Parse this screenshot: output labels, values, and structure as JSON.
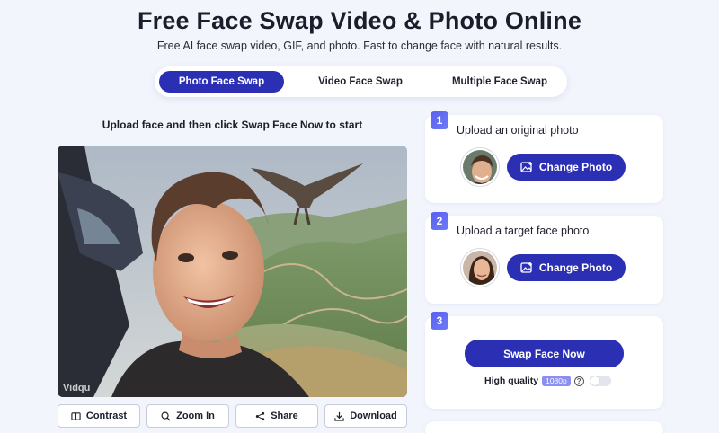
{
  "header": {
    "title": "Free Face Swap Video & Photo Online",
    "subtitle": "Free AI face swap video, GIF, and photo. Fast to change face with natural results."
  },
  "tabs": [
    {
      "label": "Photo Face Swap",
      "active": true
    },
    {
      "label": "Video Face Swap",
      "active": false
    },
    {
      "label": "Multiple Face Swap",
      "active": false
    }
  ],
  "preview": {
    "hint": "Upload face and then click Swap Face Now to start",
    "watermark": "Vidqu"
  },
  "actions": [
    {
      "label": "Contrast",
      "icon": "contrast-icon"
    },
    {
      "label": "Zoom In",
      "icon": "zoom-in-icon"
    },
    {
      "label": "Share",
      "icon": "share-icon"
    },
    {
      "label": "Download",
      "icon": "download-icon"
    }
  ],
  "steps": [
    {
      "number": "1",
      "label": "Upload an original photo",
      "button": "Change Photo"
    },
    {
      "number": "2",
      "label": "Upload a target face photo",
      "button": "Change Photo"
    },
    {
      "number": "3",
      "button": "Swap Face Now"
    }
  ],
  "quality": {
    "label": "High quality",
    "badge": "1080p",
    "help": "?",
    "enabled": false
  },
  "colors": {
    "accent": "#2b2fb3",
    "badge": "#6c7cf7",
    "background": "#f3f5fd"
  }
}
